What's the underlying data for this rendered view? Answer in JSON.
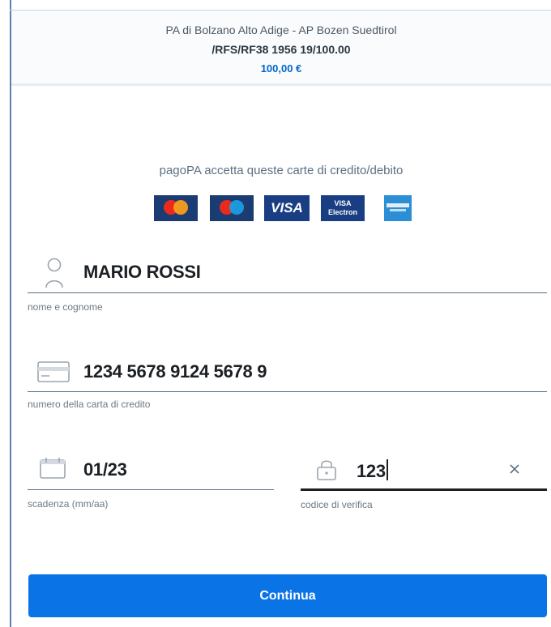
{
  "header": {
    "organization": "PA di Bolzano Alto Adige - AP Bozen Suedtirol",
    "payment_code": "/RFS/RF38 1956 19/100.00",
    "amount": "100,00 €"
  },
  "accepted_cards": {
    "text": "pagoPA accetta queste carte di credito/debito",
    "brands": [
      "mastercard",
      "maestro",
      "VISA",
      "VISA Electron",
      "american express"
    ],
    "visa_label": "VISA",
    "electron_top": "VISA",
    "electron_bottom": "Electron"
  },
  "form": {
    "name": {
      "value": "MARIO ROSSI",
      "label": "nome e cognome",
      "icon": "user-icon"
    },
    "card_number": {
      "value": "1234 5678 9124 5678 9",
      "label": "numero della carta di credito",
      "icon": "credit-card-icon"
    },
    "expiry": {
      "value": "01/23",
      "label": "scadenza (mm/aa)",
      "icon": "calendar-icon"
    },
    "cvv": {
      "value": "123",
      "label": "codice di verifica",
      "icon": "lock-icon"
    }
  },
  "actions": {
    "continue_label": "Continua"
  },
  "colors": {
    "accent": "#0a73e6",
    "amount": "#0066cc",
    "text": "#1c2024"
  }
}
